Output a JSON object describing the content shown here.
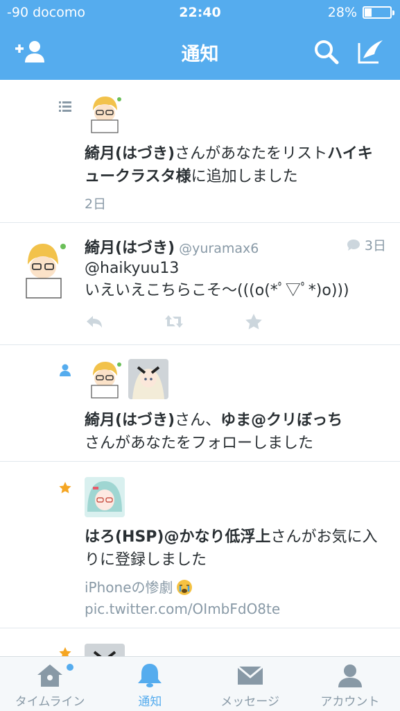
{
  "status_bar": {
    "carrier": "-90 docomo",
    "time": "22:40",
    "battery": "28%"
  },
  "nav": {
    "title": "通知"
  },
  "notifications": [
    {
      "type": "list",
      "actor": "綺月(はづき)",
      "text_mid": "さんがあなたをリスト",
      "list_name": "ハイキュークラスタ様",
      "text_end": "に追加しました",
      "time": "2日"
    },
    {
      "type": "tweet",
      "name": "綺月(はづき)",
      "handle": "@yuramax6",
      "time": "3日",
      "mention": "@haikyuu13",
      "body": "いえいえこちらこそ〜(((o(*ﾟ▽ﾟ*)o)))"
    },
    {
      "type": "follow",
      "actor1": "綺月(はづき)",
      "sep": "さん、",
      "actor2": "ゆま@クリぼっち",
      "text_end": "さんがあなたをフォローしました"
    },
    {
      "type": "favorite",
      "actor": "はろ(HSP)@かなり低浮上",
      "text_end": "さんがお気に入りに登録しました",
      "tweet_text": "iPhoneの惨劇",
      "tweet_link": "pic.twitter.com/OImbFdO8te"
    }
  ],
  "tabs": [
    {
      "label": "タイムライン",
      "icon": "home-icon"
    },
    {
      "label": "通知",
      "icon": "bell-icon"
    },
    {
      "label": "メッセージ",
      "icon": "envelope-icon"
    },
    {
      "label": "アカウント",
      "icon": "person-icon"
    }
  ],
  "colors": {
    "accent": "#55acee",
    "muted": "#8899a6",
    "star": "#f5a623"
  }
}
